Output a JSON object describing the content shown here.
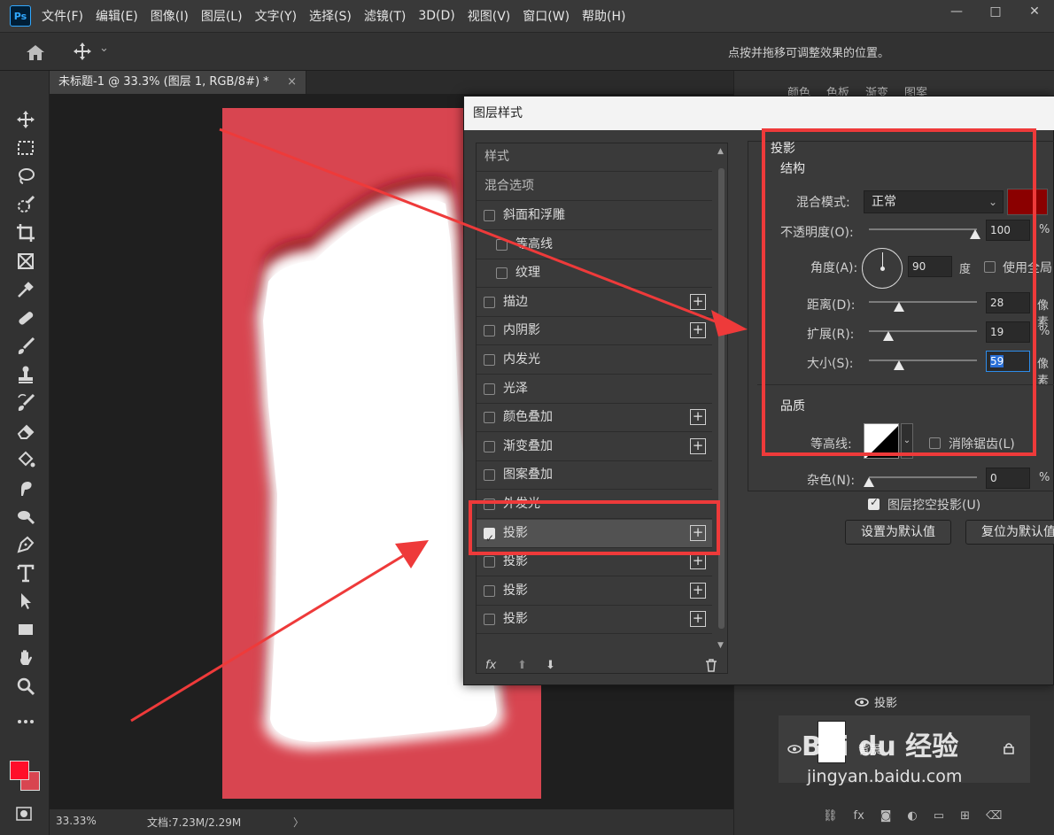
{
  "app": {
    "logo": "Ps",
    "menus": [
      "文件(F)",
      "编辑(E)",
      "图像(I)",
      "图层(L)",
      "文字(Y)",
      "选择(S)",
      "滤镜(T)",
      "3D(D)",
      "视图(V)",
      "窗口(W)",
      "帮助(H)"
    ],
    "window_buttons": [
      "—",
      "□",
      "✕"
    ]
  },
  "options_bar": {
    "hint": "点按并拖移可调整效果的位置。",
    "move_dropdown": "⌄"
  },
  "document": {
    "tab_title": "未标题-1 @ 33.3% (图层 1, RGB/8#) *",
    "tab_close": "×",
    "zoom": "33.33%",
    "doc_info": "文档:7.23M/2.29M",
    "status_arrow": "〉"
  },
  "right_panel": {
    "tabs": [
      "颜色",
      "色板",
      "渐变",
      "图案"
    ],
    "layer_effect": "投影",
    "layer_bg_name": "背景"
  },
  "dialog": {
    "title": "图层样式",
    "list_header": "样式",
    "blend_options": "混合选项",
    "items": [
      {
        "label": "斜面和浮雕",
        "indent": false,
        "plus": false,
        "checked": false
      },
      {
        "label": "等高线",
        "indent": true,
        "plus": false,
        "checked": false
      },
      {
        "label": "纹理",
        "indent": true,
        "plus": false,
        "checked": false
      },
      {
        "label": "描边",
        "indent": false,
        "plus": true,
        "checked": false
      },
      {
        "label": "内阴影",
        "indent": false,
        "plus": true,
        "checked": false
      },
      {
        "label": "内发光",
        "indent": false,
        "plus": false,
        "checked": false
      },
      {
        "label": "光泽",
        "indent": false,
        "plus": false,
        "checked": false
      },
      {
        "label": "颜色叠加",
        "indent": false,
        "plus": true,
        "checked": false
      },
      {
        "label": "渐变叠加",
        "indent": false,
        "plus": true,
        "checked": false
      },
      {
        "label": "图案叠加",
        "indent": false,
        "plus": false,
        "checked": false
      },
      {
        "label": "外发光",
        "indent": false,
        "plus": false,
        "checked": false
      },
      {
        "label": "投影",
        "indent": false,
        "plus": true,
        "checked": true,
        "selected": true
      },
      {
        "label": "投影",
        "indent": false,
        "plus": true,
        "checked": false
      },
      {
        "label": "投影",
        "indent": false,
        "plus": true,
        "checked": false
      },
      {
        "label": "投影",
        "indent": false,
        "plus": true,
        "checked": false
      }
    ],
    "plus_glyph": "+",
    "footer": {
      "fx": "fx",
      "up": "⬆",
      "down": "⬇",
      "trash": "🗑"
    },
    "settings": {
      "section": "投影",
      "structure": "结构",
      "blend_mode_label": "混合模式:",
      "blend_mode_value": "正常",
      "shadow_color": "#8b0000",
      "opacity_label": "不透明度(O):",
      "opacity_value": "100",
      "angle_label": "角度(A):",
      "angle_value": "90",
      "angle_unit": "度",
      "global_light_label": "使用全局",
      "distance_label": "距离(D):",
      "distance_value": "28",
      "spread_label": "扩展(R):",
      "spread_value": "19",
      "size_label": "大小(S):",
      "size_value": "59",
      "unit_px": "像素",
      "unit_pct": "%",
      "quality": "品质",
      "contour_label": "等高线:",
      "anti_alias_label": "消除锯齿(L)",
      "noise_label": "杂色(N):",
      "noise_value": "0",
      "knockout_label": "图层挖空投影(U)",
      "btn_default": "设置为默认值",
      "btn_reset": "复位为默认值"
    }
  },
  "watermark": {
    "text": "Bai du 经验",
    "url": "jingyan.baidu.com"
  }
}
